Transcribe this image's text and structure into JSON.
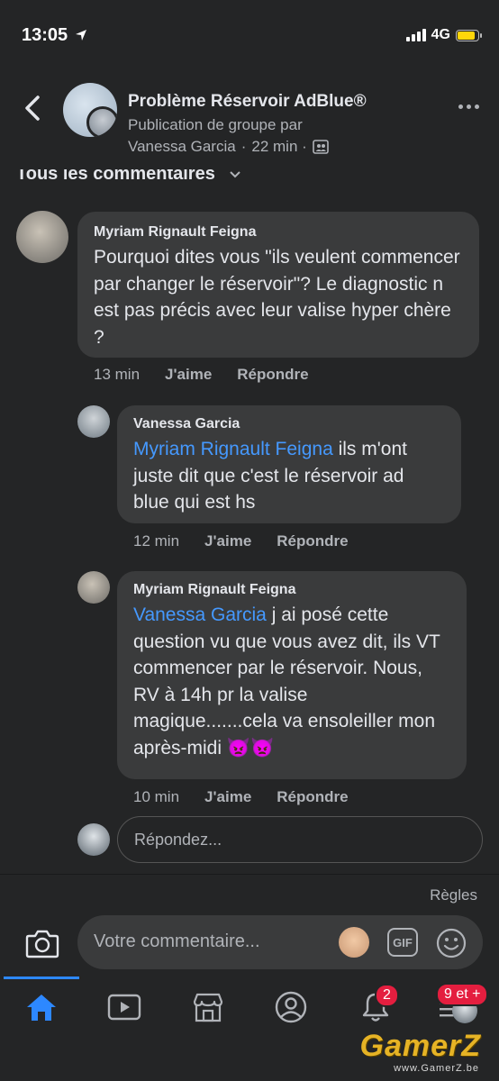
{
  "status": {
    "time": "13:05",
    "network": "4G"
  },
  "header": {
    "title": "Problème Réservoir AdBlue®",
    "subtitle": "Publication de groupe par",
    "author": "Vanessa Garcia",
    "time": "22 min ·"
  },
  "filter_label": "Tous les commentaires",
  "comments": [
    {
      "author": "Myriam Rignault Feigna",
      "text": "Pourquoi dites vous \"ils veulent commencer par changer le réservoir\"? Le diagnostic n est pas précis avec leur valise hyper chère ?",
      "time": "13 min",
      "like": "J'aime",
      "reply": "Répondre"
    },
    {
      "author": "Vanessa Garcia",
      "mention": "Myriam Rignault Feigna",
      "text": " ils m'ont juste dit que c'est le réservoir ad blue qui est hs",
      "time": "12 min",
      "like": "J'aime",
      "reply": "Répondre"
    },
    {
      "author": "Myriam Rignault Feigna",
      "mention": "Vanessa Garcia",
      "text": " j ai posé cette question vu que vous avez dit, ils VT commencer par le réservoir. Nous, RV à 14h pr la valise magique.......cela va ensoleiller mon après-midi 👿👿",
      "time": "10 min",
      "like": "J'aime",
      "reply": "Répondre"
    }
  ],
  "reply_placeholder": "Répondez...",
  "rules_link": "Règles",
  "comment_placeholder": "Votre commentaire...",
  "gif_label": "GIF",
  "nav": {
    "notifications_badge": "2",
    "menu_badge": "9 et +"
  },
  "watermark": {
    "brand": "GamerZ",
    "url": "www.GamerZ.be"
  },
  "colors": {
    "background": "#242526",
    "bubble": "#3a3b3c",
    "mention": "#4599ff",
    "accent": "#2d88ff",
    "badge": "#e41e3f"
  }
}
